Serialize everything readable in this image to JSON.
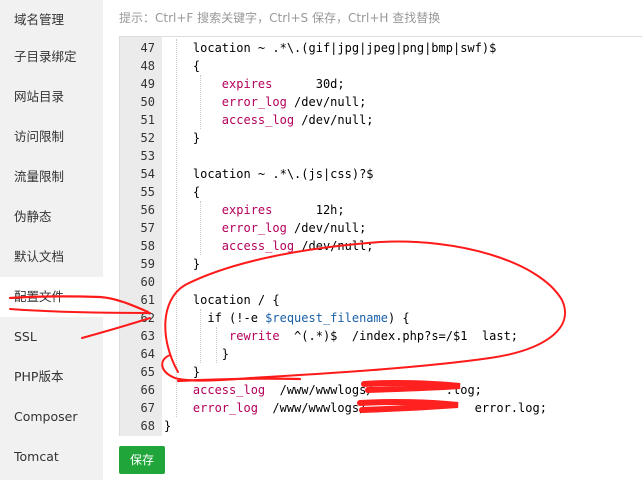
{
  "sidebar": {
    "items": [
      {
        "label": "域名管理"
      },
      {
        "label": "子目录绑定"
      },
      {
        "label": "网站目录"
      },
      {
        "label": "访问限制"
      },
      {
        "label": "流量限制"
      },
      {
        "label": "伪静态"
      },
      {
        "label": "默认文档"
      },
      {
        "label": "配置文件"
      },
      {
        "label": "SSL"
      },
      {
        "label": "PHP版本"
      },
      {
        "label": "Composer"
      },
      {
        "label": "Tomcat"
      }
    ],
    "active_index": 7
  },
  "hint": "提示：Ctrl+F 搜索关键字，Ctrl+S 保存，Ctrl+H 查找替换",
  "editor": {
    "lines": [
      {
        "n": "47",
        "text": "    location ~ .*\\.(gif|jpg|jpeg|png|bmp|swf)$"
      },
      {
        "n": "48",
        "text": "    {"
      },
      {
        "n": "49",
        "text": "        expires      30d;"
      },
      {
        "n": "50",
        "text": "        error_log /dev/null;"
      },
      {
        "n": "51",
        "text": "        access_log /dev/null;"
      },
      {
        "n": "52",
        "text": "    }"
      },
      {
        "n": "53",
        "text": ""
      },
      {
        "n": "54",
        "text": "    location ~ .*\\.(js|css)?$"
      },
      {
        "n": "55",
        "text": "    {"
      },
      {
        "n": "56",
        "text": "        expires      12h;"
      },
      {
        "n": "57",
        "text": "        error_log /dev/null;"
      },
      {
        "n": "58",
        "text": "        access_log /dev/null;"
      },
      {
        "n": "59",
        "text": "    }"
      },
      {
        "n": "60",
        "text": ""
      },
      {
        "n": "61",
        "text": "    location / {"
      },
      {
        "n": "62",
        "text": "      if (!-e $request_filename) {"
      },
      {
        "n": "63",
        "text": "         rewrite  ^(.*)$  /index.php?s=/$1  last;"
      },
      {
        "n": "64",
        "text": "        }"
      },
      {
        "n": "65",
        "text": "    }"
      },
      {
        "n": "66",
        "text": "    access_log  /www/wwwlogs/          .log;"
      },
      {
        "n": "67",
        "text": "    error_log  /www/wwwlogs/               error.log;"
      },
      {
        "n": "68",
        "text": "}"
      }
    ]
  },
  "save_label": "保存",
  "colors": {
    "sidebar_bg": "#f1f1f1",
    "gutter_bg": "#ebebeb",
    "save_button": "#20a53a",
    "directive": "#b4005a",
    "variable": "#1a5fa8",
    "annotation": "#ff0000"
  }
}
